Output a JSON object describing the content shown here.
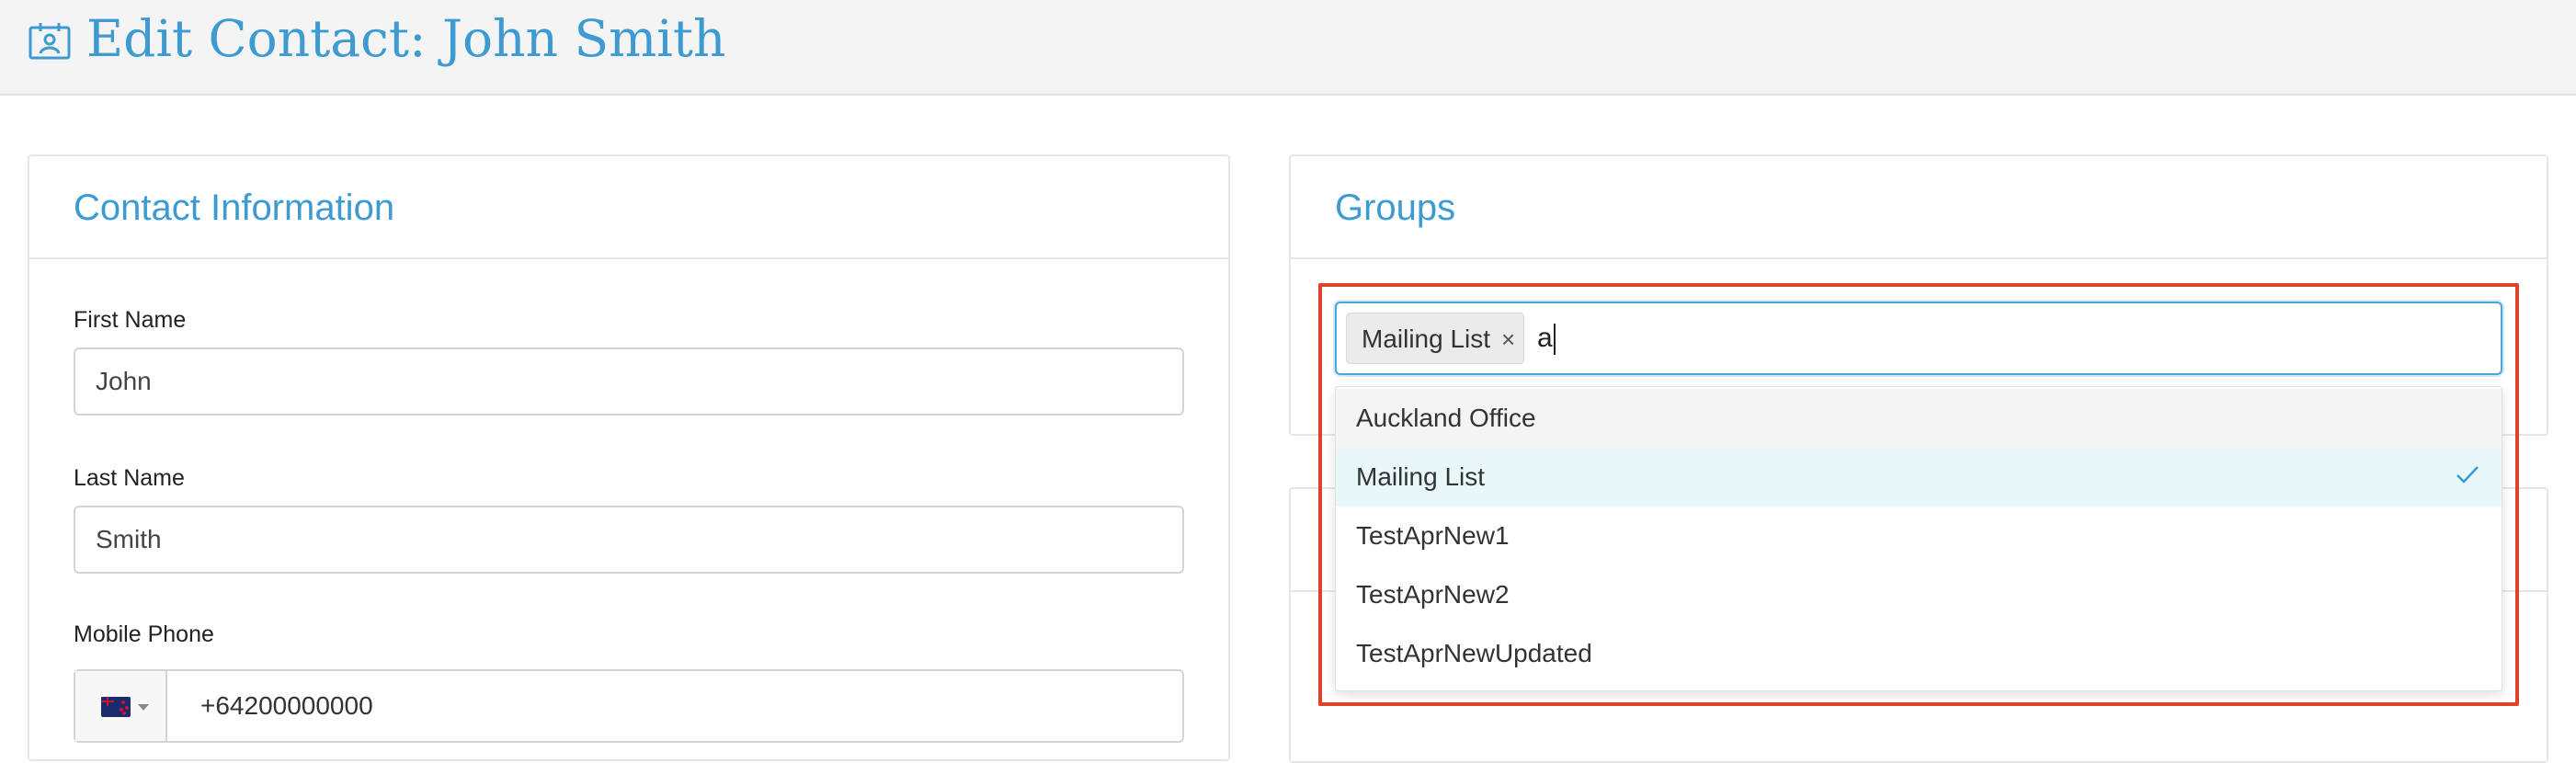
{
  "header": {
    "title": "Edit Contact: John Smith",
    "icon": "contact-card-icon"
  },
  "contact_card": {
    "title": "Contact Information",
    "first_name": {
      "label": "First Name",
      "value": "John"
    },
    "last_name": {
      "label": "Last Name",
      "value": "Smith"
    },
    "mobile_phone": {
      "label": "Mobile Phone",
      "country_flag": "new-zealand-flag-icon",
      "value": "+64200000000"
    }
  },
  "groups_card": {
    "title": "Groups",
    "selected_tags": [
      {
        "label": "Mailing List",
        "remove": "×"
      }
    ],
    "search_text": "a",
    "options": [
      {
        "label": "Auckland Office",
        "state": "hover"
      },
      {
        "label": "Mailing List",
        "state": "selected"
      },
      {
        "label": "TestAprNew1",
        "state": ""
      },
      {
        "label": "TestAprNew2",
        "state": ""
      },
      {
        "label": "TestAprNewUpdated",
        "state": ""
      }
    ]
  },
  "colors": {
    "accent": "#3d9bd1",
    "highlight_border": "#e0422c",
    "selected_bg": "#e7f7fa",
    "focus_border": "#4ba6de"
  }
}
